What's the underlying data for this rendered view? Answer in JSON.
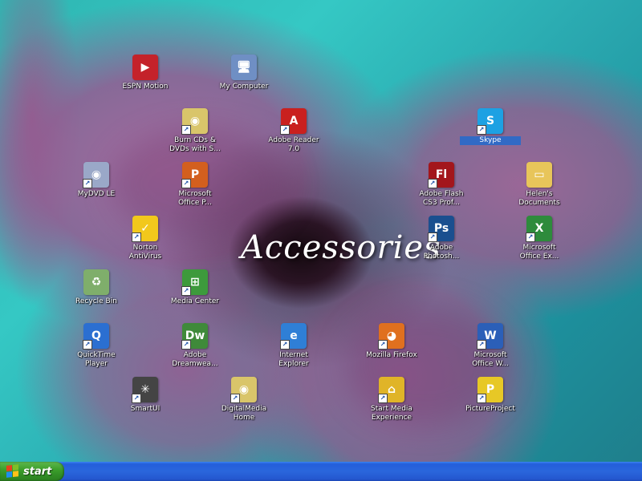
{
  "desktop": {
    "wallpaper_text": "Accessories",
    "icons": [
      {
        "label": "ESPN Motion",
        "icon": "espn-motion-icon",
        "color": "#c4222a",
        "glyph": "▶",
        "shortcut": false,
        "selected": false
      },
      {
        "label": "My Computer",
        "icon": "computer-icon",
        "color": "#6f8fc4",
        "glyph": "🖥",
        "shortcut": false,
        "selected": false
      },
      {
        "label": "Burn CDs &\nDVDs with S...",
        "icon": "cd-burn-icon",
        "color": "#d9c56a",
        "glyph": "◉",
        "shortcut": true,
        "selected": false
      },
      {
        "label": "Adobe Reader\n7.0",
        "icon": "adobe-reader-icon",
        "color": "#c9201f",
        "glyph": "A",
        "shortcut": true,
        "selected": false
      },
      {
        "label": "Skype",
        "icon": "skype-icon",
        "color": "#1da1e3",
        "glyph": "S",
        "shortcut": true,
        "selected": true
      },
      {
        "label": "MyDVD LE",
        "icon": "dvd-icon",
        "color": "#9aa8c8",
        "glyph": "◉",
        "shortcut": true,
        "selected": false
      },
      {
        "label": "Microsoft\nOffice P...",
        "icon": "powerpoint-icon",
        "color": "#d35f1e",
        "glyph": "P",
        "shortcut": true,
        "selected": false
      },
      {
        "label": "Adobe Flash\nCS3 Prof...",
        "icon": "flash-icon",
        "color": "#a3161c",
        "glyph": "Fl",
        "shortcut": true,
        "selected": false
      },
      {
        "label": "Helen's\nDocuments",
        "icon": "folder-icon",
        "color": "#e8c55a",
        "glyph": "▭",
        "shortcut": false,
        "selected": false
      },
      {
        "label": "Norton\nAntiVirus",
        "icon": "norton-icon",
        "color": "#f2c81c",
        "glyph": "✓",
        "shortcut": true,
        "selected": false
      },
      {
        "label": "Adobe\nPhotosh...",
        "icon": "photoshop-icon",
        "color": "#1a4f8f",
        "glyph": "Ps",
        "shortcut": true,
        "selected": false
      },
      {
        "label": "Microsoft\nOffice Ex...",
        "icon": "excel-icon",
        "color": "#2e8b3c",
        "glyph": "X",
        "shortcut": true,
        "selected": false
      },
      {
        "label": "Recycle Bin",
        "icon": "recycle-bin-icon",
        "color": "#7fae6b",
        "glyph": "♻",
        "shortcut": false,
        "selected": false
      },
      {
        "label": "Media Center",
        "icon": "media-center-icon",
        "color": "#3d9a3c",
        "glyph": "⊞",
        "shortcut": true,
        "selected": false
      },
      {
        "label": "QuickTime\nPlayer",
        "icon": "quicktime-icon",
        "color": "#2b6fd1",
        "glyph": "Q",
        "shortcut": true,
        "selected": false
      },
      {
        "label": "Adobe\nDreamwea...",
        "icon": "dreamweaver-icon",
        "color": "#3f8a3a",
        "glyph": "Dw",
        "shortcut": true,
        "selected": false
      },
      {
        "label": "Internet\nExplorer",
        "icon": "internet-explorer-icon",
        "color": "#2f7fd6",
        "glyph": "e",
        "shortcut": true,
        "selected": false
      },
      {
        "label": "Mozilla Firefox",
        "icon": "firefox-icon",
        "color": "#e0701f",
        "glyph": "◕",
        "shortcut": true,
        "selected": false
      },
      {
        "label": "Microsoft\nOffice W...",
        "icon": "word-icon",
        "color": "#2b5fb8",
        "glyph": "W",
        "shortcut": true,
        "selected": false
      },
      {
        "label": "SmartUI",
        "icon": "smartui-icon",
        "color": "#444444",
        "glyph": "✳",
        "shortcut": true,
        "selected": false
      },
      {
        "label": "DigitalMedia\nHome",
        "icon": "digitalmedia-icon",
        "color": "#d9c56a",
        "glyph": "◉",
        "shortcut": true,
        "selected": false
      },
      {
        "label": "Start Media\nExperience",
        "icon": "home-icon",
        "color": "#e0b428",
        "glyph": "⌂",
        "shortcut": true,
        "selected": false
      },
      {
        "label": "PictureProject",
        "icon": "pictureproject-icon",
        "color": "#e7c826",
        "glyph": "P",
        "shortcut": true,
        "selected": false
      }
    ]
  },
  "taskbar": {
    "start_label": "start"
  }
}
